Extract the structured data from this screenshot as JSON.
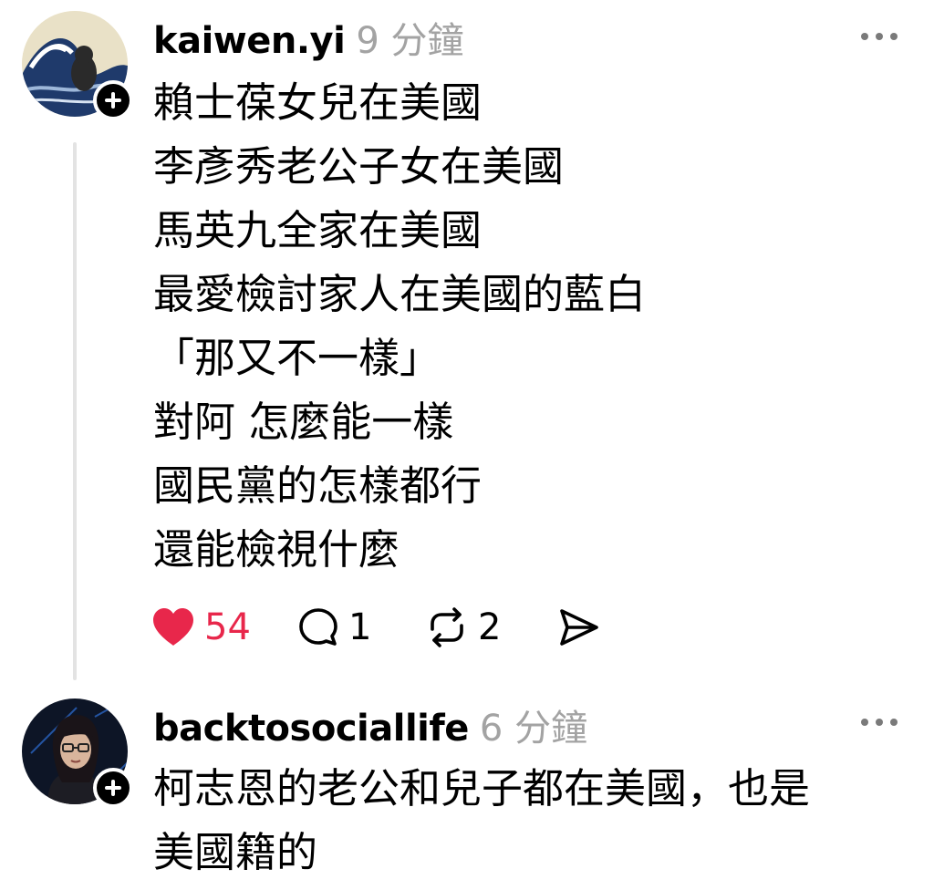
{
  "posts": [
    {
      "username": "kaiwen.yi",
      "timestamp": "9 分鐘",
      "lines": [
        "賴士葆女兒在美國",
        "李彥秀老公子女在美國",
        "馬英九全家在美國",
        "最愛檢討家人在美國的藍白",
        "「那又不一樣」",
        "對阿 怎麼能一樣",
        "國民黨的怎樣都行",
        "還能檢視什麼"
      ],
      "likes": "54",
      "comments": "1",
      "reposts": "2"
    },
    {
      "username": "backtosociallife",
      "timestamp": "6 分鐘",
      "lines": [
        "柯志恩的老公和兒子都在美國，也是",
        "美國籍的"
      ]
    }
  ],
  "icons": {
    "follow": "plus-icon",
    "more": "ellipsis-icon",
    "like": "heart-icon",
    "comment": "comment-icon",
    "repost": "repost-icon",
    "share": "send-icon"
  },
  "colors": {
    "like_active": "#e8274b",
    "timestamp": "#a3a3a3",
    "thread_line": "#e3e3e3"
  }
}
